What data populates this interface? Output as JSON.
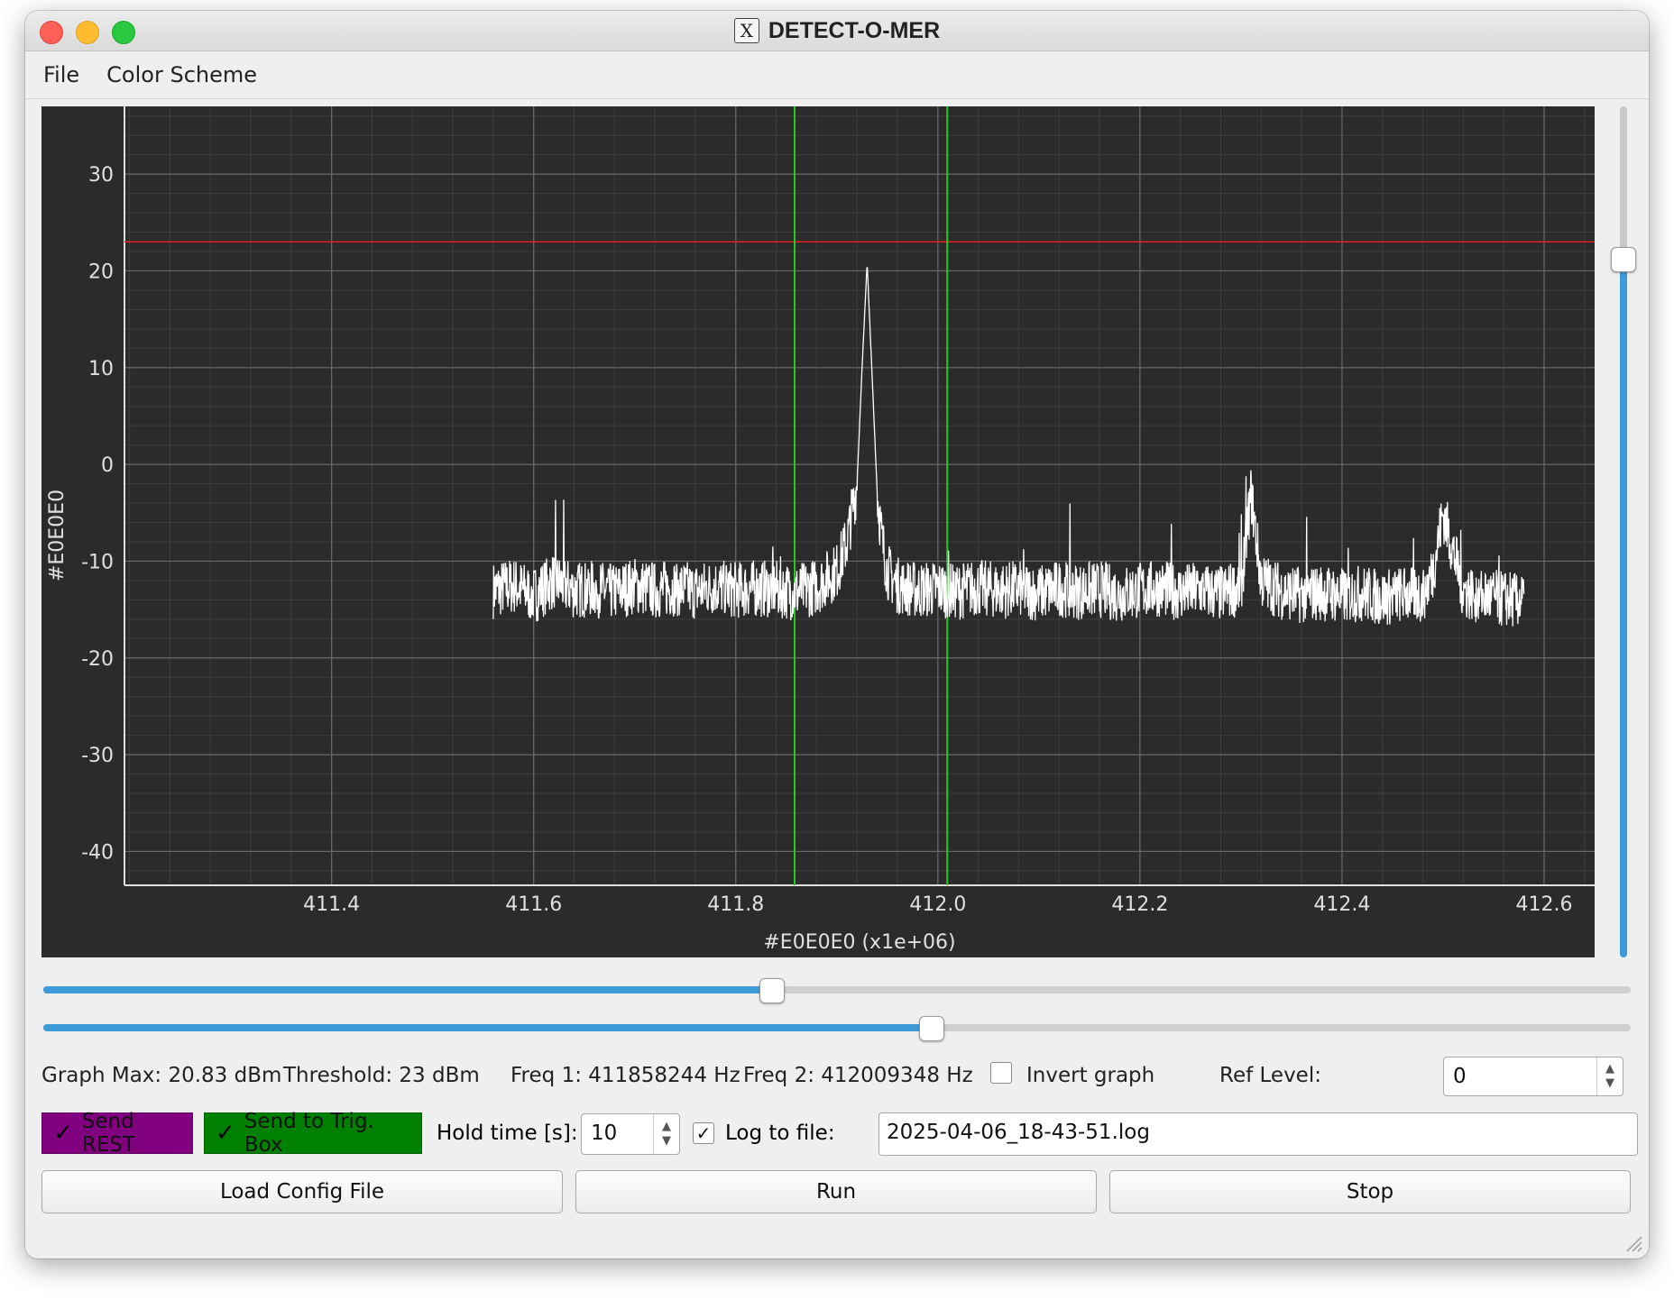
{
  "window": {
    "title": "DETECT-O-MER",
    "app_icon": "x11-icon"
  },
  "menu": {
    "items": [
      "File",
      "Color Scheme"
    ]
  },
  "chart_data": {
    "type": "line",
    "title": "",
    "xlabel": "#E0E0E0 (x1e+06)",
    "ylabel": "#E0E0E0",
    "xlim": [
      411.195,
      412.65
    ],
    "ylim": [
      -43.5,
      37
    ],
    "x_ticks": [
      "411.4",
      "411.6",
      "411.8",
      "412.0",
      "412.2",
      "412.4",
      "412.6"
    ],
    "x_tick_values": [
      411.4,
      411.6,
      411.8,
      412.0,
      412.2,
      412.4,
      412.6
    ],
    "y_ticks": [
      "30",
      "20",
      "10",
      "0",
      "-10",
      "-20",
      "-30",
      "-40"
    ],
    "y_tick_values": [
      30,
      20,
      10,
      0,
      -10,
      -20,
      -30,
      -40
    ],
    "grid": true,
    "background": "#2b2b2b",
    "grid_color": "#6a6a6a",
    "series": [
      {
        "color": "#ffffff",
        "x": [
          411.56,
          411.58,
          411.6,
          411.62,
          411.64,
          411.66,
          411.68,
          411.7,
          411.72,
          411.74,
          411.76,
          411.78,
          411.8,
          411.82,
          411.84,
          411.86,
          411.88,
          411.9,
          411.91,
          411.92,
          411.925,
          411.93,
          411.935,
          411.94,
          411.945,
          411.95,
          411.96,
          411.98,
          412.0,
          412.02,
          412.04,
          412.06,
          412.08,
          412.1,
          412.12,
          412.14,
          412.16,
          412.18,
          412.2,
          412.22,
          412.24,
          412.26,
          412.28,
          412.3,
          412.31,
          412.32,
          412.34,
          412.36,
          412.38,
          412.4,
          412.42,
          412.44,
          412.46,
          412.48,
          412.49,
          412.5,
          412.52,
          412.54,
          412.56,
          412.58
        ],
        "y": [
          -13,
          -12.5,
          -13.5,
          -12,
          -13,
          -12.8,
          -13.2,
          -12.5,
          -13,
          -12.7,
          -13.1,
          -12.6,
          -13,
          -12.8,
          -12.9,
          -13.2,
          -12.6,
          -11,
          -8,
          -2,
          10,
          20.8,
          9,
          -3,
          -8,
          -11,
          -12.5,
          -13,
          -12.8,
          -13.1,
          -12.7,
          -13,
          -12.9,
          -13.3,
          -12.8,
          -13.1,
          -12.9,
          -13.4,
          -13,
          -12.8,
          -13.2,
          -13,
          -13.4,
          -12.6,
          -3,
          -12,
          -13.1,
          -13.5,
          -13.2,
          -13.6,
          -13.3,
          -13.8,
          -13.4,
          -13.5,
          -11,
          -5,
          -13,
          -13.6,
          -13.9,
          -14
        ]
      }
    ],
    "threshold": {
      "y": 23,
      "color": "#e32020"
    },
    "markers": [
      {
        "x": 411.858244,
        "color": "#22cc22"
      },
      {
        "x": 412.009348,
        "color": "#22cc22"
      }
    ]
  },
  "vertical_slider": {
    "level": 0.83
  },
  "slider_freq1": {
    "level": 0.458
  },
  "slider_freq2": {
    "level": 0.56
  },
  "status": {
    "graph_max": "Graph Max: 20.83 dBm",
    "threshold": "Threshold: 23 dBm",
    "freq1": "Freq 1: 411858244 Hz",
    "freq2": "Freq 2: 412009348 Hz",
    "invert_label": "Invert graph",
    "invert_checked": "",
    "ref_level_label": "Ref Level:",
    "ref_level_value": "0"
  },
  "controls": {
    "send_rest_label": "Send REST",
    "send_rest_color": "#800080",
    "send_rest_check": "✓",
    "send_trig_label": "Send to Trig. Box",
    "send_trig_color": "#008000",
    "send_trig_check": "✓",
    "hold_time_label": "Hold time [s]:",
    "hold_time_value": "10",
    "log_checked": "✓",
    "log_label": "Log to file:",
    "log_file_value": "2025-04-06_18-43-51.log"
  },
  "buttons": {
    "load": "Load Config File",
    "run": "Run",
    "stop": "Stop"
  }
}
